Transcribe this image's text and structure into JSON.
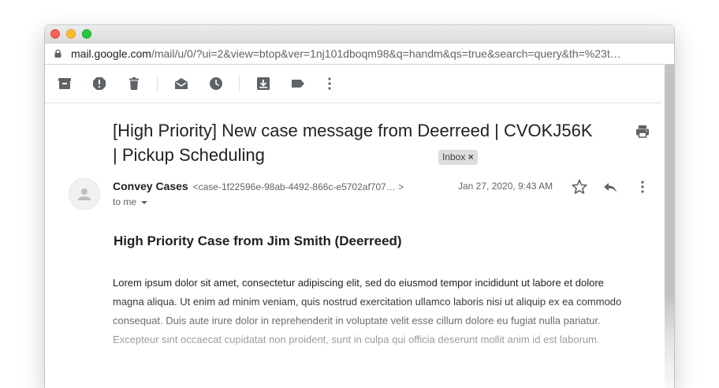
{
  "browser": {
    "url_host": "mail.google.com",
    "url_path": "/mail/u/0/?ui=2&view=btop&ver=1nj101dboqm98&q=handm&qs=true&search=query&th=%23t…"
  },
  "toolbar": {
    "icons": [
      "archive-icon",
      "report-spam-icon",
      "delete-icon",
      "mark-unread-icon",
      "snooze-icon",
      "move-to-icon",
      "label-icon",
      "more-icon"
    ]
  },
  "email": {
    "subject": "[High Priority] New case message from Deerreed | CVOKJ56K | Pickup Scheduling",
    "label": "Inbox",
    "label_remove": "×",
    "sender_name": "Convey Cases",
    "sender_email": "<case-1f22596e-98ab-4492-866c-e5702af707… >",
    "to": "to me",
    "date": "Jan 27, 2020, 9:43 AM",
    "heading": "High Priority Case from Jim Smith (Deerreed)",
    "body": "Lorem ipsum dolor sit amet, consectetur adipiscing elit, sed do eiusmod tempor incididunt ut labore et dolore magna aliqua. Ut enim ad minim veniam, quis nostrud exercitation ullamco laboris nisi ut aliquip ex ea commodo consequat. Duis aute irure dolor in reprehenderit in voluptate velit esse cillum dolore eu fugiat nulla pariatur. Excepteur sint occaecat cupidatat non proident, sunt in culpa qui officia deserunt mollit anim id est laborum."
  }
}
